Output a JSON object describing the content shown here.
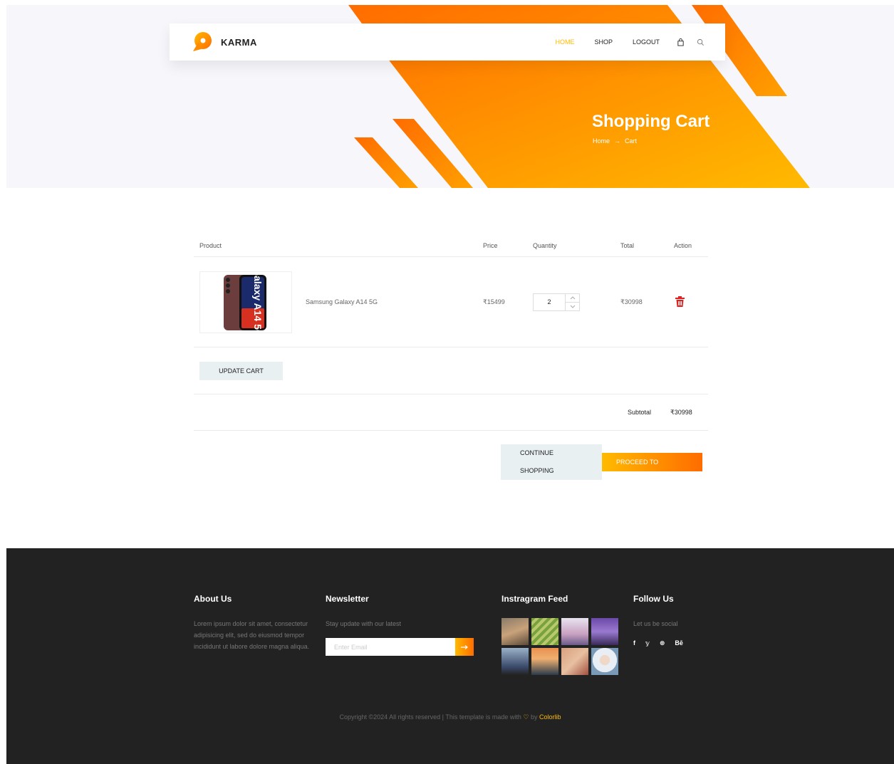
{
  "header": {
    "brand": "KARMA",
    "nav": [
      {
        "label": "HOME",
        "active": true
      },
      {
        "label": "SHOP",
        "active": false
      },
      {
        "label": "LOGOUT",
        "active": false
      }
    ],
    "icons": [
      "shopping-bag-icon",
      "search-icon"
    ]
  },
  "banner": {
    "title": "Shopping Cart",
    "breadcrumb": [
      "Home",
      "Cart"
    ]
  },
  "cart": {
    "columns": {
      "product": "Product",
      "price": "Price",
      "quantity": "Quantity",
      "total": "Total",
      "action": "Action"
    },
    "items": [
      {
        "name": "Samsung Galaxy A14 5G",
        "image_text": "Galaxy A14 5G",
        "price": "₹15499",
        "quantity": "2",
        "total": "₹30998"
      }
    ],
    "update_label": "UPDATE CART",
    "subtotal_label": "Subtotal",
    "subtotal_value": "₹30998",
    "continue_line1": "CONTINUE",
    "continue_line2": "SHOPPING",
    "proceed_label": "PROCEED TO"
  },
  "footer": {
    "about_title": "About Us",
    "about_text": "Lorem ipsum dolor sit amet, consectetur adipisicing elit, sed do eiusmod tempor incididunt ut labore dolore magna aliqua.",
    "newsletter_title": "Newsletter",
    "newsletter_text": "Stay update with our latest",
    "newsletter_placeholder": "Enter Email",
    "insta_title": "Instragram Feed",
    "follow_title": "Follow Us",
    "follow_text": "Let us be social",
    "social": [
      "f",
      "𝕪",
      "⊛",
      "Bē"
    ],
    "copyright_prefix": "Copyright ©2024 All rights reserved | This template is made with",
    "copyright_by": "by",
    "copyright_brand": "Colorlib"
  },
  "colors": {
    "accent": "#ffba00",
    "accent_dark": "#ff6c00",
    "footer_bg": "#222222",
    "delete": "#e02020"
  }
}
